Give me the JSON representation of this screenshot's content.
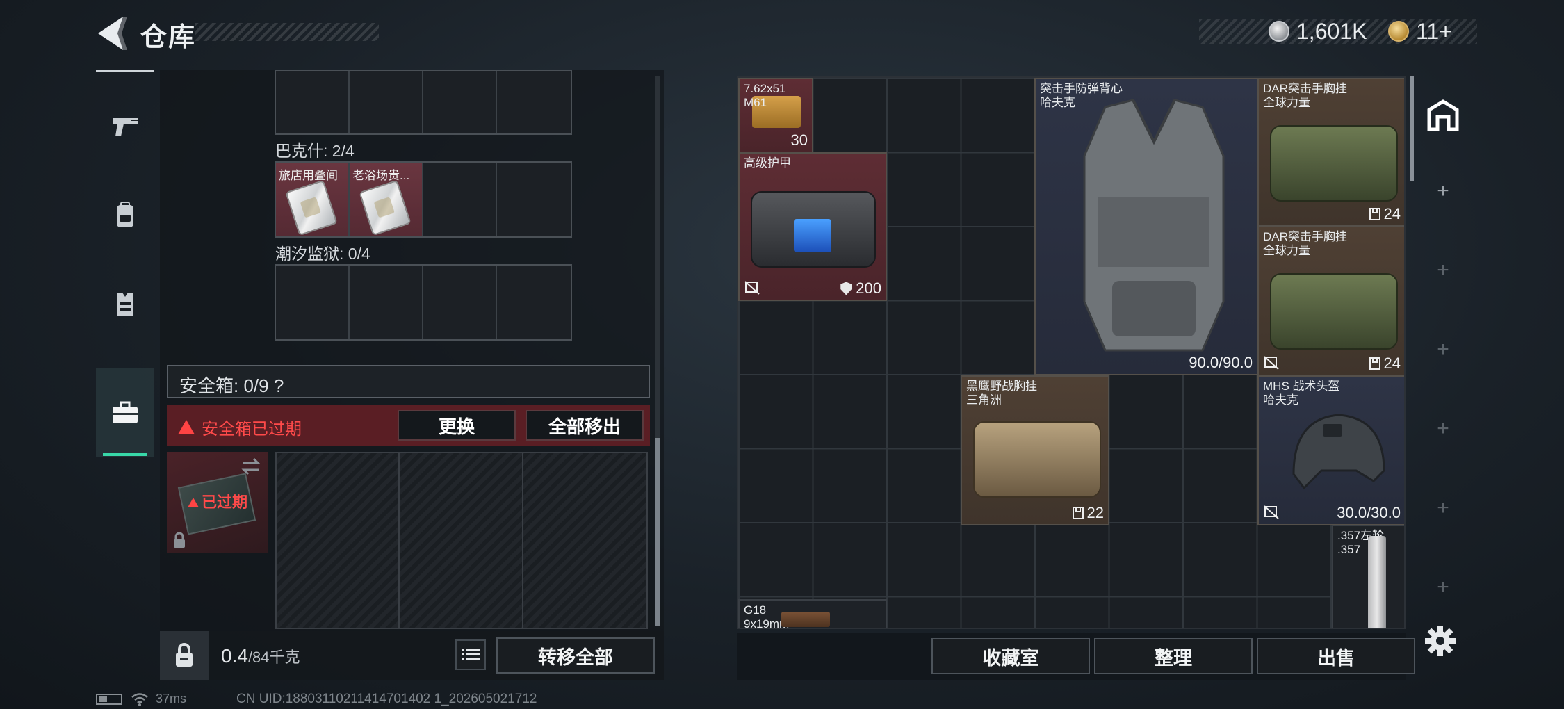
{
  "header": {
    "title": "仓库",
    "currency_silver": "1,601K",
    "currency_gold": "11+"
  },
  "side_nav": [
    {
      "icon": "pistol-icon"
    },
    {
      "icon": "backpack-icon"
    },
    {
      "icon": "vest-icon"
    },
    {
      "icon": "briefcase-icon",
      "active": true
    }
  ],
  "left_panel": {
    "group_bakshi_label": "巴克什: 2/4",
    "group_bakshi_items": [
      "旅店用叠间",
      "老浴场贵..."
    ],
    "group_tide_label": "潮汐监狱: 0/4",
    "safe_label": "安全箱: 0/9 ?",
    "safe_expired_text": "安全箱已过期",
    "btn_replace": "更换",
    "btn_move_all_out": "全部移出",
    "safe_box_status": "已过期",
    "weight_value": "0.4",
    "weight_max": "/84千克",
    "btn_transfer_all": "转移全部"
  },
  "stash": {
    "items": [
      {
        "id": "ammo",
        "name": "7.62x51\nM61",
        "qty": "30"
      },
      {
        "id": "armor-case",
        "name": "高级护甲",
        "qty": "200"
      },
      {
        "id": "assault-vest",
        "name": "突击手防弹背心\n哈夫克",
        "qty": "90.0/90.0"
      },
      {
        "id": "dar-rig-1",
        "name": "DAR突击手胸挂\n全球力量",
        "qty": "24"
      },
      {
        "id": "dar-rig-2",
        "name": "DAR突击手胸挂\n全球力量",
        "qty": "24"
      },
      {
        "id": "black-eagle-rig",
        "name": "黑鹰野战胸挂\n三角洲",
        "qty": "22"
      },
      {
        "id": "mhs-helmet",
        "name": "MHS 战术头盔\n哈夫克",
        "qty": "30.0/30.0"
      },
      {
        "id": "revolver",
        "name": ".357左轮\n.357",
        "qty": ""
      },
      {
        "id": "g18",
        "name": "G18\n9x19mm",
        "qty": ""
      }
    ]
  },
  "bottom_buttons": {
    "collection": "收藏室",
    "organize": "整理",
    "sell": "出售"
  },
  "status_bar": {
    "ping": "37ms",
    "uid": "CN UID:18803110211414701402 1_202605021712"
  },
  "colors": {
    "accent_green": "#38d8a8",
    "expired_red": "#ff4a4a",
    "item_red_bg": "#5e2d34",
    "item_blue_bg": "#2e3446",
    "item_brown_bg": "#4f4034"
  }
}
